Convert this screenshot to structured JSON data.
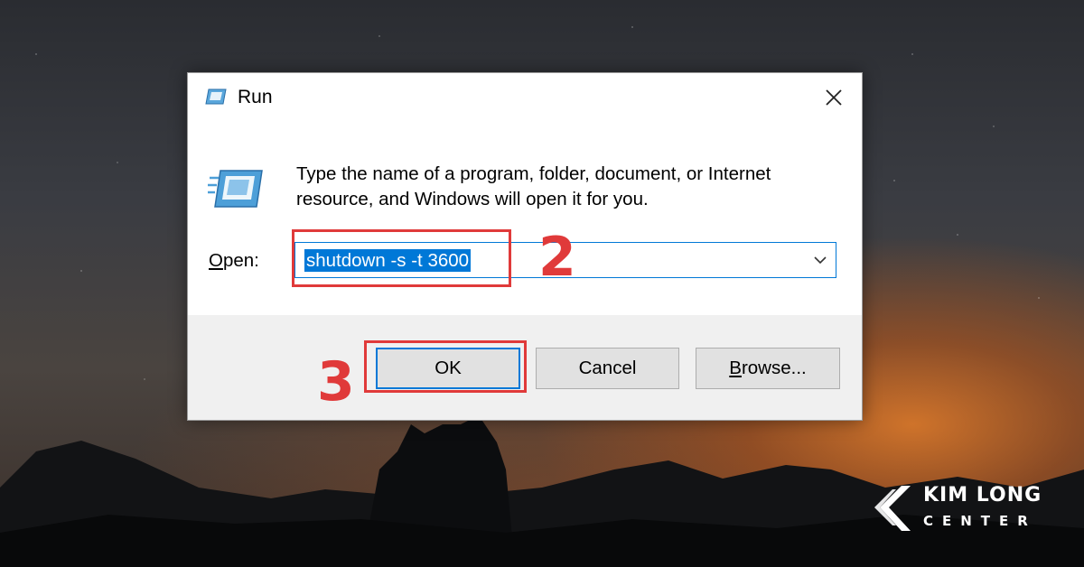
{
  "dialog": {
    "title": "Run",
    "close_icon": "close-icon",
    "description": "Type the name of a program, folder, document, or Internet resource, and Windows will open it for you.",
    "open_label_accel": "O",
    "open_label_rest": "pen:",
    "open_value": "shutdown -s -t 3600",
    "buttons": {
      "ok": "OK",
      "cancel": "Cancel",
      "browse_accel": "B",
      "browse_rest": "rowse..."
    }
  },
  "annotations": {
    "step_2": "2",
    "step_3": "3",
    "highlight_color": "#e03a3a"
  },
  "brand": {
    "line1": "KIM LONG",
    "line2": "CENTER"
  },
  "colors": {
    "accent": "#0078d7",
    "footer_bg": "#f0f0f0",
    "button_bg": "#e1e1e1"
  }
}
